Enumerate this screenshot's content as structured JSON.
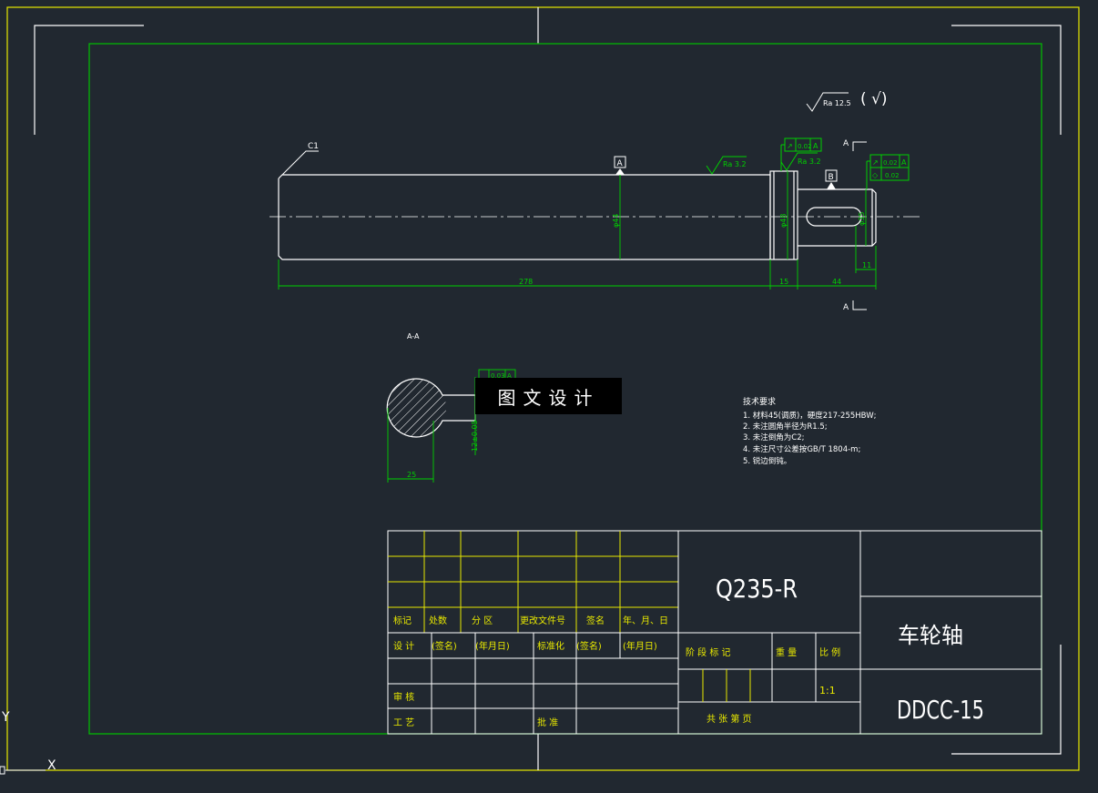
{
  "drawing": {
    "surface_finish_general": "Ra 12.5",
    "surface_finish_paren": "( √)",
    "leader_note": "C1",
    "datum_a": "A",
    "datum_b": "B",
    "section_marker": "A",
    "section_label": "A-A",
    "roughness_a": "Ra 3.2",
    "roughness_b": "Ra 3.2",
    "gdt_1": [
      "↗",
      "0.02",
      "A"
    ],
    "gdt_2": [
      "↗",
      "0.02",
      "A"
    ],
    "gdt_3": [
      "◇",
      "0.02",
      ""
    ],
    "gdt_section": [
      "",
      "0.03",
      "A"
    ],
    "dim_main_len": "278",
    "dim_collar": "15",
    "dim_end": "44",
    "dim_keyway": "11",
    "dim_dia_main": "φ44",
    "dim_dia_collar": "φ48",
    "dim_dia_end": "φ35",
    "dim_section_w": "25",
    "dim_section_key": "12±0.05"
  },
  "tech_req": {
    "title": "技术要求",
    "lines": [
      "1. 材料45(调质)，硬度217-255HBW;",
      "2. 未注圆角半径为R1.5;",
      "3. 未注倒角为C2;",
      "4. 未注尺寸公差按GB/T 1804-m;",
      "5. 锐边倒钝。"
    ]
  },
  "title_block": {
    "material": "Q235-R",
    "part_name": "车轮轴",
    "drawing_no": "DDCC-15",
    "headers": [
      "标记",
      "处数",
      "分 区",
      "更改文件号",
      "签名",
      "年、月、日"
    ],
    "design_row": [
      "设 计",
      "(签名)",
      "(年月日)",
      "标准化",
      "(签名)",
      "(年月日)"
    ],
    "review": "审 核",
    "process": "工 艺",
    "approve": "批 准",
    "stage": "阶 段 标 记",
    "weight": "重 量",
    "scale": "比 例",
    "scale_value": "1:1",
    "sheets": "共   张   第   页"
  },
  "ucs": {
    "y": "Y",
    "x": "X"
  },
  "watermark": "图文设计",
  "colors": {
    "bg": "#212830",
    "border": "#00c000",
    "outer": "#e8e800",
    "line": "#ffffff",
    "dim": "#00d000",
    "yellow": "#e8e800"
  }
}
